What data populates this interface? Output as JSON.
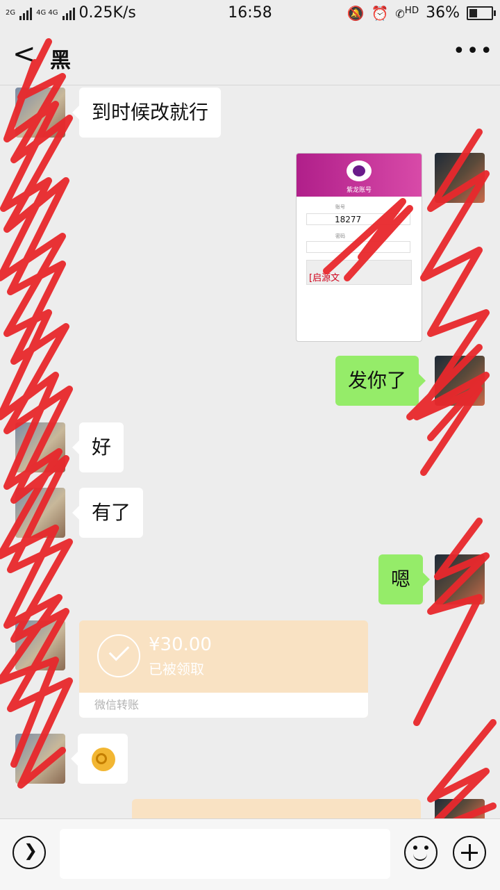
{
  "status_bar": {
    "signal_1": "2G",
    "signal_2": "4G 4G",
    "speed": "0.25K/s",
    "time": "16:58",
    "hd": "HD",
    "battery_pct": "36%",
    "battery_level": 0.36
  },
  "header": {
    "contact_name": "黑",
    "back_label": "<",
    "more_label": "•••"
  },
  "messages": {
    "m1": "到时候改就行",
    "image_card": {
      "header_text": "紫龙账号",
      "field_label_1": "账号",
      "field_value_1": "18277",
      "field_label_2": "密码",
      "tag": "[启源文"
    },
    "m3": "发你了",
    "m4": "好",
    "m5": "有了",
    "m6": "嗯",
    "transfer_1": {
      "amount": "¥30.00",
      "status": "已被领取",
      "footer": "微信转账"
    },
    "emoji_name": "ok-hand-emoji"
  },
  "input_bar": {
    "placeholder": ""
  },
  "colors": {
    "sent_bubble": "#95ec69",
    "transfer_bg": "#f9e2c3",
    "scribble": "#e8282c"
  }
}
